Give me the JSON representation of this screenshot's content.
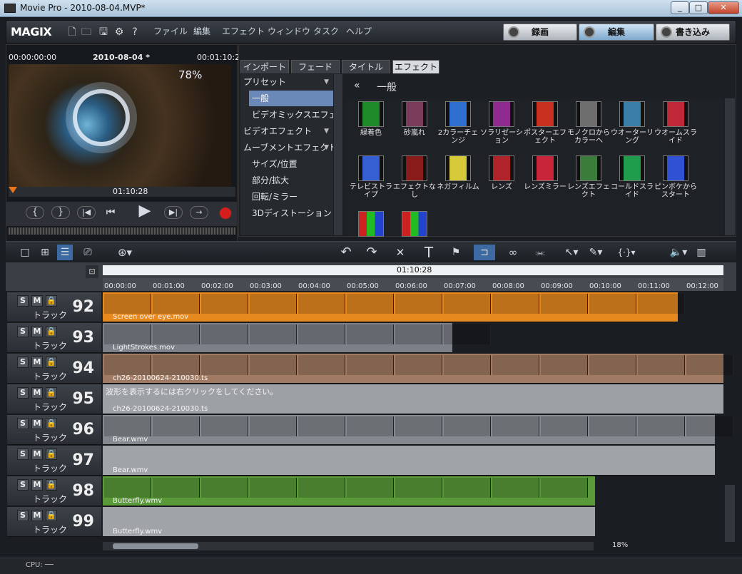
{
  "window": {
    "title": "Movie Pro - 2010-08-04.MVP*",
    "btn_min": "_",
    "btn_max": "□",
    "btn_close": "✕"
  },
  "menubar": {
    "logo": "MAGIX",
    "items": [
      "ファイル",
      "編集",
      "エフェクト",
      "ウィンドウ",
      "タスク",
      "ヘルプ"
    ],
    "modes": [
      {
        "label": "録画"
      },
      {
        "label": "編集"
      },
      {
        "label": "書き込み"
      }
    ]
  },
  "preview": {
    "tc_start": "00:00:00:00",
    "project": "2010-08-04 *",
    "tc_end": "00:01:10:28",
    "tc_current": "01:10:28",
    "overlay_percent": "78%"
  },
  "effects": {
    "tabs": [
      "インポート",
      "フェード",
      "タイトル",
      "エフェクト"
    ],
    "header": "一般",
    "list": [
      {
        "label": "プリセット",
        "arrow": "▼"
      },
      {
        "label": "一般",
        "arrow": ""
      },
      {
        "label": "ビデオミックスエフェク",
        "arrow": ""
      },
      {
        "label": "ビデオエフェクト",
        "arrow": "▼"
      },
      {
        "label": "ムーブメントエフェクト",
        "arrow": "▼"
      },
      {
        "label": "サイズ/位置",
        "arrow": ""
      },
      {
        "label": "部分/拡大",
        "arrow": ""
      },
      {
        "label": "回転/ミラー",
        "arrow": ""
      },
      {
        "label": "3Dディストーション",
        "arrow": ""
      }
    ],
    "items": [
      {
        "label": "緑着色",
        "color": "#1f8a2a"
      },
      {
        "label": "砂嵐れ",
        "color": "#7a3c5a"
      },
      {
        "label": "2カラーチェンジ",
        "color": "#2f6fd0"
      },
      {
        "label": "ソラリゼーション",
        "color": "#8e2a90"
      },
      {
        "label": "ポスターエフェクト",
        "color": "#c8311f"
      },
      {
        "label": "モノクロからカラーへ",
        "color": "#6e6e6e"
      },
      {
        "label": "ウオーターリング",
        "color": "#3a7fa8"
      },
      {
        "label": "ウオームスライド",
        "color": "#c0283a"
      },
      {
        "label": "テレビストライプ",
        "color": "#355fd2"
      },
      {
        "label": "エフェクトなし",
        "color": "#8a1b1b"
      },
      {
        "label": "ネガフィルム",
        "color": "#d6c93a"
      },
      {
        "label": "レンズ",
        "color": "#b0232b"
      },
      {
        "label": "レンズミラー",
        "color": "#c8243a"
      },
      {
        "label": "レンズエフェクト",
        "color": "#3b7c3b"
      },
      {
        "label": "コールドスライド",
        "color": "#1f9d4c"
      },
      {
        "label": "ピンボケからスタート",
        "color": "#2f52d4"
      }
    ]
  },
  "ruler": {
    "position": "01:10:28",
    "ticks": [
      "00:00:00",
      "00:01:00",
      "00:02:00",
      "00:03:00",
      "00:04:00",
      "00:05:00",
      "00:06:00",
      "00:07:00",
      "00:08:00",
      "00:09:00",
      "00:10:00",
      "00:11:00",
      "00:12:00"
    ]
  },
  "tracks": [
    {
      "num": "92",
      "label": "トラック",
      "clip": "Screen over eye.mov",
      "color": "#e6891f"
    },
    {
      "num": "93",
      "label": "トラック",
      "clip": "LightStrokes.mov",
      "color": "#7c8088"
    },
    {
      "num": "94",
      "label": "トラック",
      "clip": "ch26-20100624-210030.ts",
      "color": "#a07a62"
    },
    {
      "num": "95",
      "label": "トラック",
      "clip": "ch26-20100624-210030.ts",
      "color": "#9da1a6",
      "message": "波形を表示するには右クリックをしてください。"
    },
    {
      "num": "96",
      "label": "トラック",
      "clip": "Bear.wmv",
      "color": "#84898f"
    },
    {
      "num": "97",
      "label": "トラック",
      "clip": "Bear.wmv",
      "color": "#a0a4a9"
    },
    {
      "num": "98",
      "label": "トラック",
      "clip": "Butterfly.wmv",
      "color": "#5a9a3a"
    },
    {
      "num": "99",
      "label": "トラック",
      "clip": "Butterfly.wmv",
      "color": "#a0a4a9"
    }
  ],
  "statusbar": {
    "cpu": "CPU: ──",
    "zoom": "18%"
  }
}
